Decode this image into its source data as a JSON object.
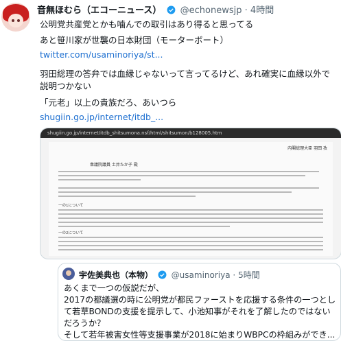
{
  "tweet": {
    "author_name": "音無ほむら（エコーニュース）",
    "author_handle": "@echonewsjp",
    "separator": "·",
    "time": "4時間",
    "lines": [
      "公明党共産党とかも噛んでの取引はあり得ると思ってる",
      "あと笹川家が世襲の日本財団（モーターボート）",
      "twitter.com/usaminoriya/st...",
      "羽田総理の答弁では血縁じゃないって言ってるけど、あれ確実に血縁以外で",
      "説明つかない",
      "「元老」以上の貴族だろ、あいつら",
      "shugiin.go.jp/internet/itdb_..."
    ]
  },
  "embed_image": {
    "url_bar": "shugiin.go.jp/internet/itdb_shitsumona.nsf/html/shitsumon/b128005.htm",
    "doc_header_right": "内閣総理大臣  羽田  孜",
    "doc_title": "衆議院議員   土井たか子   殿",
    "section_1": "一の1について",
    "section_2": "一の2について"
  },
  "quote": {
    "author_name": "宇佐美典也（本物）",
    "author_handle": "@usaminoriya",
    "separator": "·",
    "time": "5時間",
    "lines": [
      "あくまで一つの仮説だが、",
      "2017の都議選の時に公明党が都民ファーストを応援する条件の一つとし",
      "て若草BONDの支援を提示して、小池知事がそれを了解したのではない",
      "だろうか？",
      "そして若年被害女性等支援事業が2018に始まりWBPCの枠組みができ..."
    ]
  },
  "colors": {
    "link": "#1d6fd0",
    "verified": "#1d9bf0",
    "border": "#cfd9de",
    "muted": "#536471"
  }
}
